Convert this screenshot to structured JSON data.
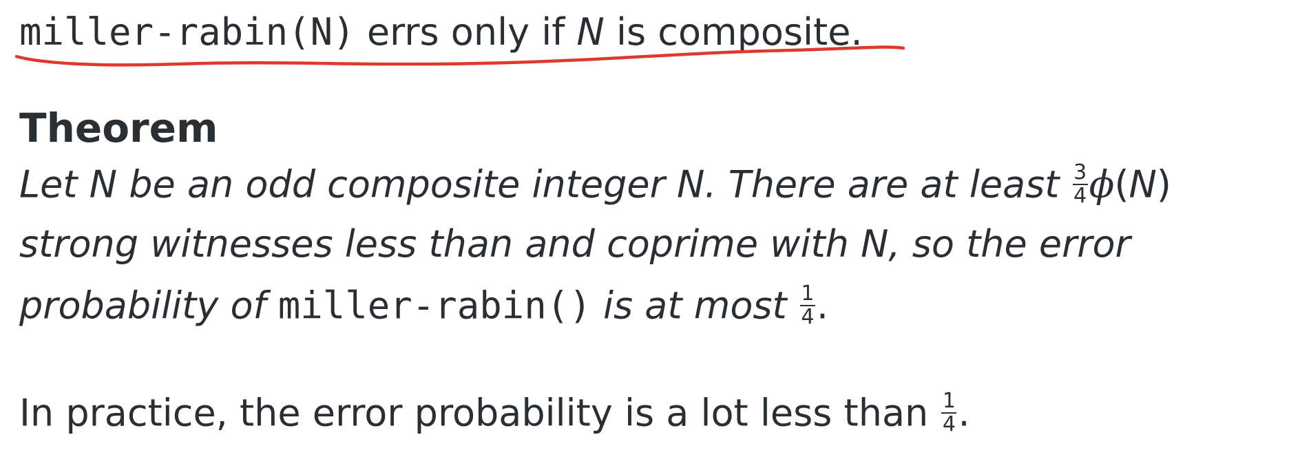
{
  "intro": {
    "code": "miller-rabin(N)",
    "text_a": " errs only if ",
    "var": "N",
    "text_b": " is composite."
  },
  "theorem": {
    "title": "Theorem",
    "line1": {
      "a": "Let ",
      "var1": "N",
      "b": " be an odd composite integer ",
      "var2": "N",
      "c": ".  There are at least ",
      "frac_num": "3",
      "frac_den": "4",
      "phi": "ϕ",
      "paren_open": "(",
      "var3": "N",
      "paren_close": ")"
    },
    "line2": {
      "a": "strong witnesses less than and coprime with ",
      "var": "N",
      "b": ", so the error"
    },
    "line3": {
      "a": "probability of ",
      "code": "miller-rabin()",
      "b": " is at most ",
      "frac_num": "1",
      "frac_den": "4",
      "c": "."
    }
  },
  "practice": {
    "text": "In practice, the error probability is a lot less than ",
    "frac_num": "1",
    "frac_den": "4",
    "end": "."
  },
  "annotation": {
    "color": "#e0392b"
  }
}
